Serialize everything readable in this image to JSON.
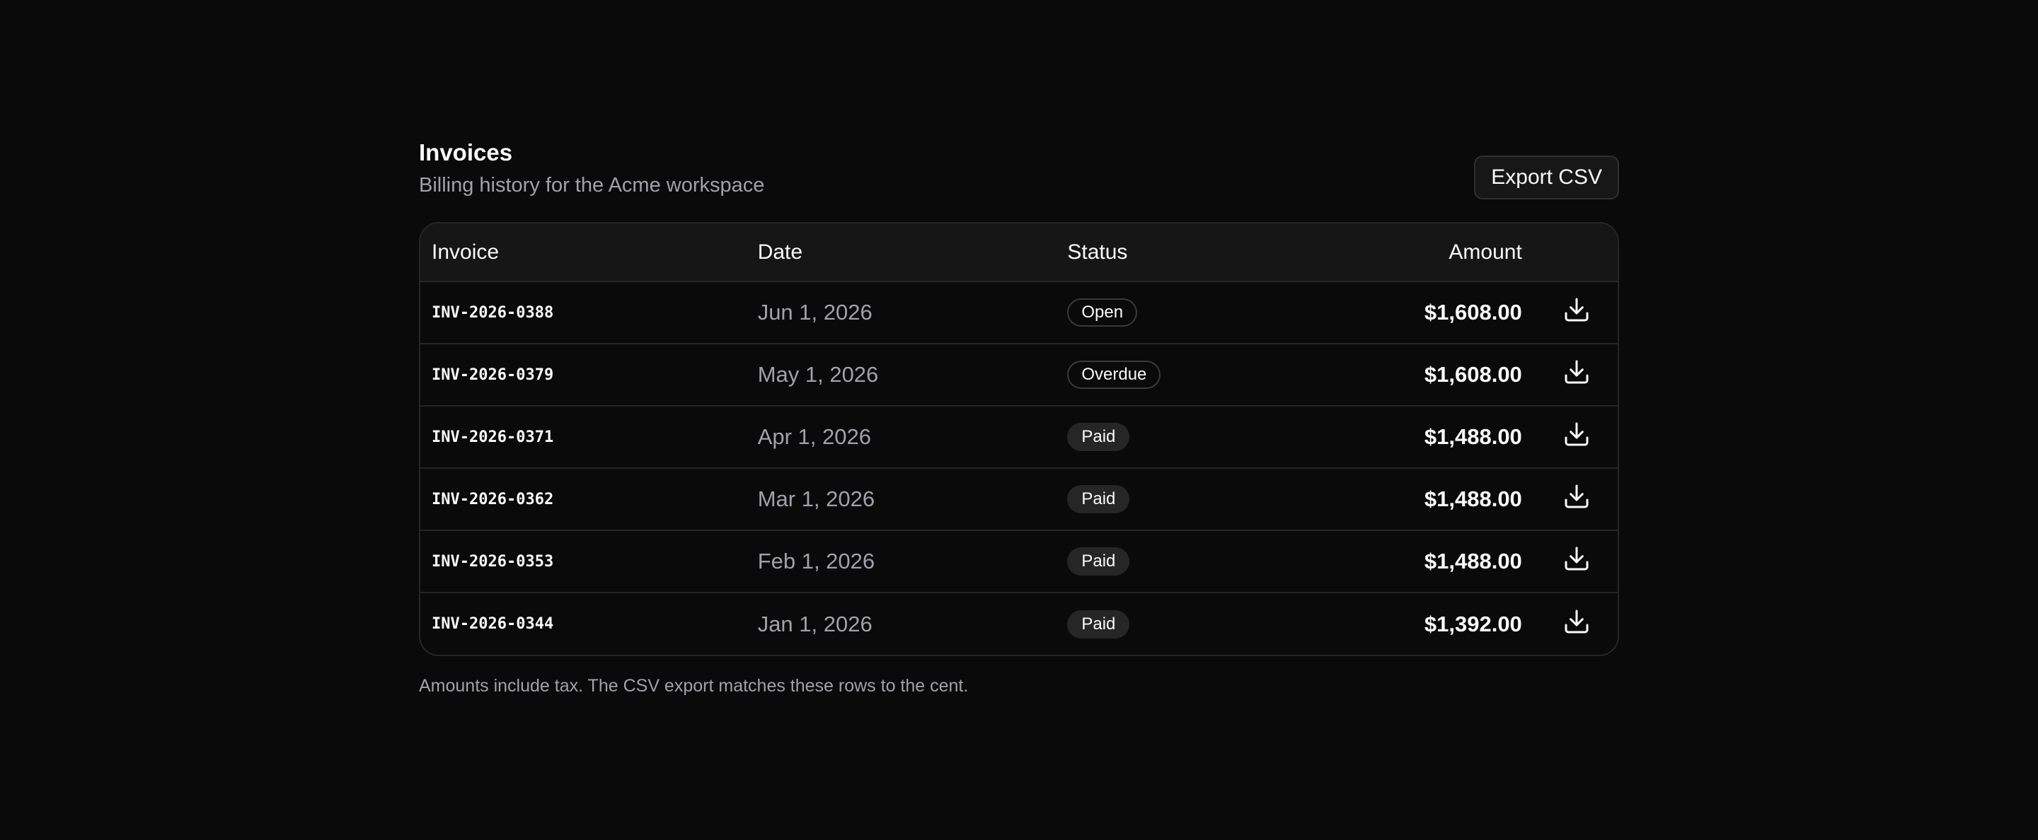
{
  "header": {
    "title": "Invoices",
    "subtitle": "Billing history for the Acme workspace",
    "export_label": "Export CSV"
  },
  "table": {
    "columns": [
      "Invoice",
      "Date",
      "Status",
      "Amount"
    ],
    "rows": [
      {
        "invoice": "INV-2026-0388",
        "date": "Jun 1, 2026",
        "status": "Open",
        "amount": "$1,608.00"
      },
      {
        "invoice": "INV-2026-0379",
        "date": "May 1, 2026",
        "status": "Overdue",
        "amount": "$1,608.00"
      },
      {
        "invoice": "INV-2026-0371",
        "date": "Apr 1, 2026",
        "status": "Paid",
        "amount": "$1,488.00"
      },
      {
        "invoice": "INV-2026-0362",
        "date": "Mar 1, 2026",
        "status": "Paid",
        "amount": "$1,488.00"
      },
      {
        "invoice": "INV-2026-0353",
        "date": "Feb 1, 2026",
        "status": "Paid",
        "amount": "$1,488.00"
      },
      {
        "invoice": "INV-2026-0344",
        "date": "Jan 1, 2026",
        "status": "Paid",
        "amount": "$1,392.00"
      }
    ],
    "row_action_icon": "download-icon"
  },
  "footnote": "Amounts include tax. The CSV export matches these rows to the cent.",
  "colors": {
    "background": "#0a0a0a",
    "header_row": "#161616",
    "border": "#262626",
    "muted_text": "#a1a1aa",
    "text": "#fafafa"
  }
}
